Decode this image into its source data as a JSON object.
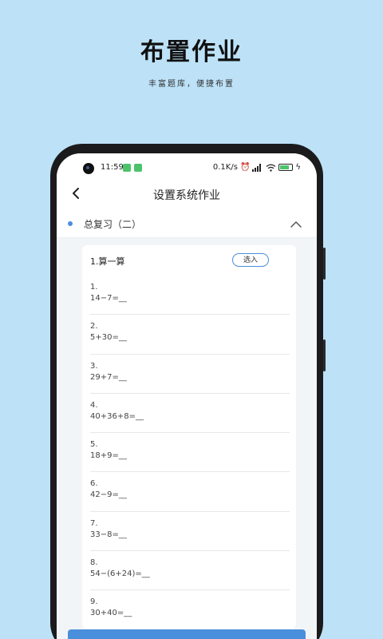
{
  "promo": {
    "title": "布置作业",
    "subtitle": "丰富题库，便捷布置"
  },
  "status_bar": {
    "time": "11:59",
    "net_speed": "0.1K/s",
    "battery_level": 0.75
  },
  "header": {
    "title": "设置系统作业"
  },
  "section": {
    "title": "总复习（二）"
  },
  "card": {
    "title": "1.算一算",
    "select_label": "选入",
    "questions": [
      {
        "num": "1.",
        "expr": "14−7=__"
      },
      {
        "num": "2.",
        "expr": "5+30=__"
      },
      {
        "num": "3.",
        "expr": "29+7=__"
      },
      {
        "num": "4.",
        "expr": "40+36+8=__"
      },
      {
        "num": "5.",
        "expr": "18+9=__"
      },
      {
        "num": "6.",
        "expr": "42−9=__"
      },
      {
        "num": "7.",
        "expr": "33−8=__"
      },
      {
        "num": "8.",
        "expr": "54−(6+24)=__"
      },
      {
        "num": "9.",
        "expr": "30+40=__"
      }
    ]
  },
  "colors": {
    "background": "#bde2f8",
    "accent": "#4a8fdc"
  }
}
